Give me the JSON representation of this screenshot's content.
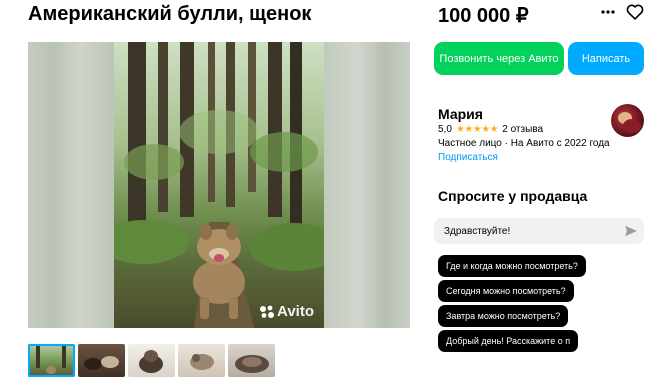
{
  "listing": {
    "title": "Американский булли, щенок",
    "price": "100 000 ₽"
  },
  "photo": {
    "watermark": "Avito",
    "thumbnail_count": 5,
    "active_thumbnail": 1
  },
  "actions": {
    "call_label": "Позвонить через Авито",
    "write_label": "Написать",
    "more_icon": "more-dots-icon",
    "favorite_icon": "heart-icon"
  },
  "seller": {
    "name": "Мария",
    "rating": "5,0",
    "reviews": "2 отзыва",
    "meta": "Частное лицо · На Авито с 2022 года",
    "subscribe_label": "Подписаться"
  },
  "ask": {
    "title": "Спросите у продавца",
    "input_value": "Здравствуйте!",
    "send_icon": "send-icon",
    "suggestions": [
      "Где и когда можно посмотреть?",
      "Сегодня можно посмотреть?",
      "Завтра можно посмотреть?",
      "Добрый день! Расскажите о п"
    ]
  },
  "colors": {
    "call_button": "#02d15c",
    "write_button": "#00aaff",
    "link": "#0099f7",
    "stars": "#ffb021"
  }
}
